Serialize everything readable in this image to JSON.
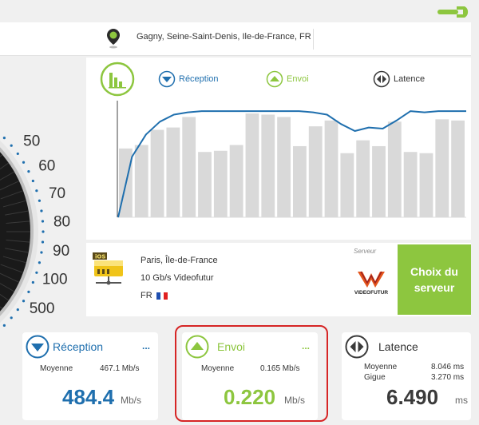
{
  "location": {
    "text": "Gagny, Seine-Saint-Denis, Ile-de-France, FR"
  },
  "gauge": {
    "ticks": [
      "50",
      "60",
      "70",
      "80",
      "90",
      "100",
      "500"
    ]
  },
  "legend": {
    "reception": "Réception",
    "envoi": "Envoi",
    "latence": "Latence"
  },
  "colors": {
    "blue": "#1f6fae",
    "green": "#8dc63f",
    "dark": "#3a3a3a",
    "bar": "#d9d9d9",
    "red": "#d62525"
  },
  "chart_data": {
    "type": "bar",
    "title": "",
    "xlabel": "",
    "ylabel": "",
    "series": [
      {
        "values": [
          0.59,
          0.62,
          0.75,
          0.77,
          0.86,
          0.56,
          0.57,
          0.62,
          0.89,
          0.88,
          0.86,
          0.61,
          0.78,
          0.83,
          0.55,
          0.66,
          0.61,
          0.82,
          0.56,
          0.55,
          0.84,
          0.83
        ]
      },
      {
        "values": [
          0.0,
          0.52,
          0.71,
          0.82,
          0.88,
          0.9,
          0.91,
          0.91,
          0.91,
          0.91,
          0.91,
          0.91,
          0.91,
          0.91,
          0.9,
          0.88,
          0.8,
          0.74,
          0.77,
          0.76,
          0.83,
          0.91,
          0.9,
          0.91,
          0.91,
          0.91
        ]
      }
    ]
  },
  "server": {
    "city": "Paris, Île-de-France",
    "provider": "10 Gb/s Videofutur",
    "country": "FR",
    "serveur_label": "Serveur",
    "logo_text": "VIDEOFUTUR",
    "icon_text": "iOS",
    "choose_button": "Choix du serveur"
  },
  "reception_card": {
    "title": "Réception",
    "dots": "...",
    "moyenne_label": "Moyenne",
    "moyenne_value": "467.1 Mb/s",
    "value": "484.4",
    "unit": "Mb/s"
  },
  "envoi_card": {
    "title": "Envoi",
    "dots": "...",
    "moyenne_label": "Moyenne",
    "moyenne_value": "0.165 Mb/s",
    "value": "0.220",
    "unit": "Mb/s"
  },
  "latence_card": {
    "title": "Latence",
    "moyenne_label": "Moyenne",
    "moyenne_value": "8.046 ms",
    "gigue_label": "Gigue",
    "gigue_value": "3.270 ms",
    "value": "6.490",
    "unit": "ms"
  }
}
